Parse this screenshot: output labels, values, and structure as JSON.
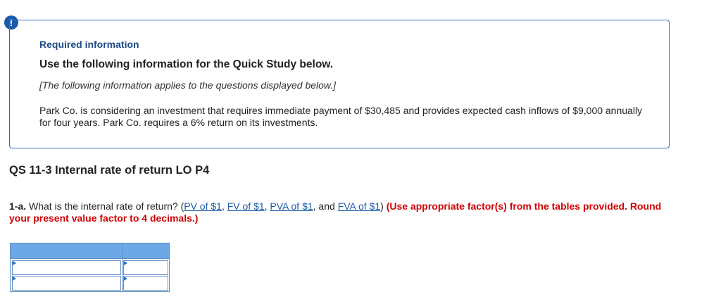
{
  "alert_icon": "!",
  "info": {
    "heading": "Required information",
    "instruction": "Use the following information for the Quick Study below.",
    "applies_note": "[The following information applies to the questions displayed below.]",
    "scenario": "Park Co. is considering an investment that requires immediate payment of $30,485 and provides expected cash inflows of $9,000 annually for four years. Park Co. requires a 6% return on its investments."
  },
  "qs_title": "QS 11-3 Internal rate of return LO P4",
  "question": {
    "part": "1-a.",
    "text_start": " What is the internal rate of return? (",
    "link_pv": "PV of $1",
    "sep1": ", ",
    "link_fv": "FV of $1",
    "sep2": ", ",
    "link_pva": "PVA of $1",
    "sep3": ", and ",
    "link_fva": "FVA of $1",
    "text_end": ") ",
    "instruction": "(Use appropriate factor(s) from the tables provided. Round your present value factor to 4 decimals.)"
  },
  "answer_table": {
    "rows": [
      {
        "label": "",
        "value": ""
      },
      {
        "label": "",
        "value": ""
      }
    ]
  },
  "colors": {
    "accent": "#1a5aa8",
    "instruction_red": "#d00000",
    "table_header": "#6ca8e8"
  }
}
